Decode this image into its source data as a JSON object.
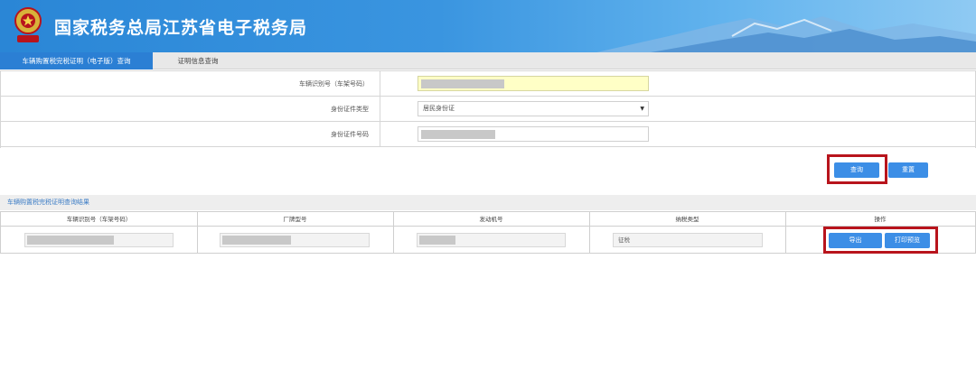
{
  "header": {
    "title": "国家税务总局江苏省电子税务局",
    "colors": {
      "banner": "#2a86d6",
      "accent": "#3c8ee6",
      "highlight": "#b8141c"
    }
  },
  "tabs": [
    {
      "label": "车辆购置税完税证明（电子版）查询",
      "active": true
    },
    {
      "label": "证明信息查询",
      "active": false
    }
  ],
  "form": {
    "vin_label": "车辆识别号（车架号码）",
    "id_type_label": "身份证件类型",
    "id_type_value": "居民身份证",
    "id_number_label": "身份证件号码"
  },
  "buttons": {
    "query": "查询",
    "reset": "重置",
    "export": "导出",
    "print_preview": "打印预览"
  },
  "results": {
    "title": "车辆购置税完税证明查询结果",
    "columns": [
      "车辆识别号（车架号码）",
      "厂牌型号",
      "发动机号",
      "纳税类型",
      "操作"
    ],
    "row": {
      "tax_type": "征税"
    }
  }
}
